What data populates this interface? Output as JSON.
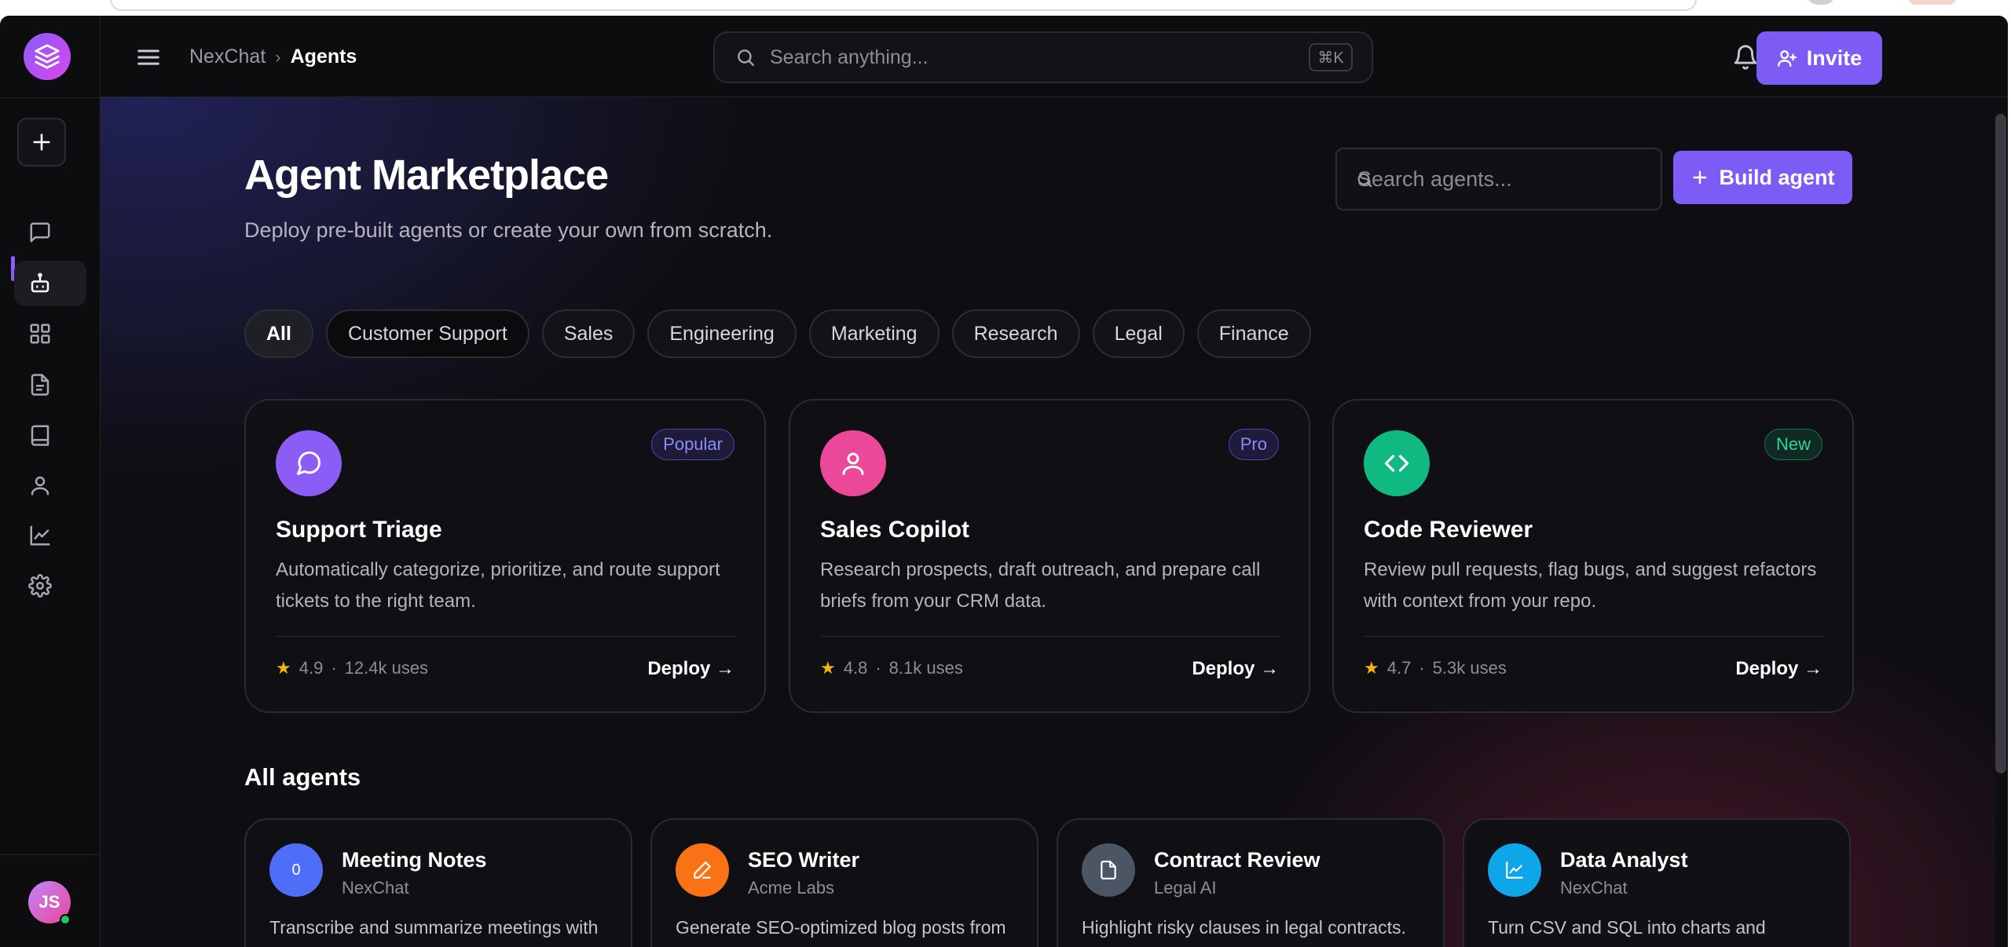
{
  "breadcrumb": {
    "root": "NexChat",
    "current": "Agents"
  },
  "global_search": {
    "placeholder": "Search anything...",
    "shortcut": "⌘K"
  },
  "header": {
    "invite_label": "Invite"
  },
  "user": {
    "initials": "JS"
  },
  "page": {
    "title": "Agent Marketplace",
    "subtitle": "Deploy pre-built agents or create your own from scratch.",
    "search_placeholder": "Search agents...",
    "build_label": "Build agent"
  },
  "filters": [
    "All",
    "Customer Support",
    "Sales",
    "Engineering",
    "Marketing",
    "Research",
    "Legal",
    "Finance"
  ],
  "featured": [
    {
      "name": "Support Triage",
      "badge": "Popular",
      "description": "Automatically categorize, prioritize, and route support tickets to the right team.",
      "rating": "4.9",
      "uses": "12.4k uses",
      "deploy": "Deploy →",
      "icon": "chat-bubble-icon",
      "color": "#8b5cf6"
    },
    {
      "name": "Sales Copilot",
      "badge": "Pro",
      "description": "Research prospects, draft outreach, and prepare call briefs from your CRM data.",
      "rating": "4.8",
      "uses": "8.1k uses",
      "deploy": "Deploy →",
      "icon": "user-icon",
      "color": "#ec4899"
    },
    {
      "name": "Code Reviewer",
      "badge": "New",
      "description": "Review pull requests, flag bugs, and suggest refactors with context from your repo.",
      "rating": "4.7",
      "uses": "5.3k uses",
      "deploy": "Deploy →",
      "icon": "code-icon",
      "color": "#10b981"
    }
  ],
  "all_agents": {
    "title": "All agents",
    "items": [
      {
        "name": "Meeting Notes",
        "org": "NexChat",
        "description": "Transcribe and summarize meetings with action items.",
        "icon_glyph": "0",
        "icon": "mic-icon",
        "color": "#4f6ef7"
      },
      {
        "name": "SEO Writer",
        "org": "Acme Labs",
        "description": "Generate SEO-optimized blog posts from keywords.",
        "icon": "pen-icon",
        "color": "#f97316"
      },
      {
        "name": "Contract Review",
        "org": "Legal AI",
        "description": "Highlight risky clauses in legal contracts.",
        "icon": "document-icon",
        "color": "#4b5563"
      },
      {
        "name": "Data Analyst",
        "org": "NexChat",
        "description": "Turn CSV and SQL into charts and insights.",
        "icon": "chart-icon",
        "color": "#0ea5e9"
      }
    ]
  }
}
